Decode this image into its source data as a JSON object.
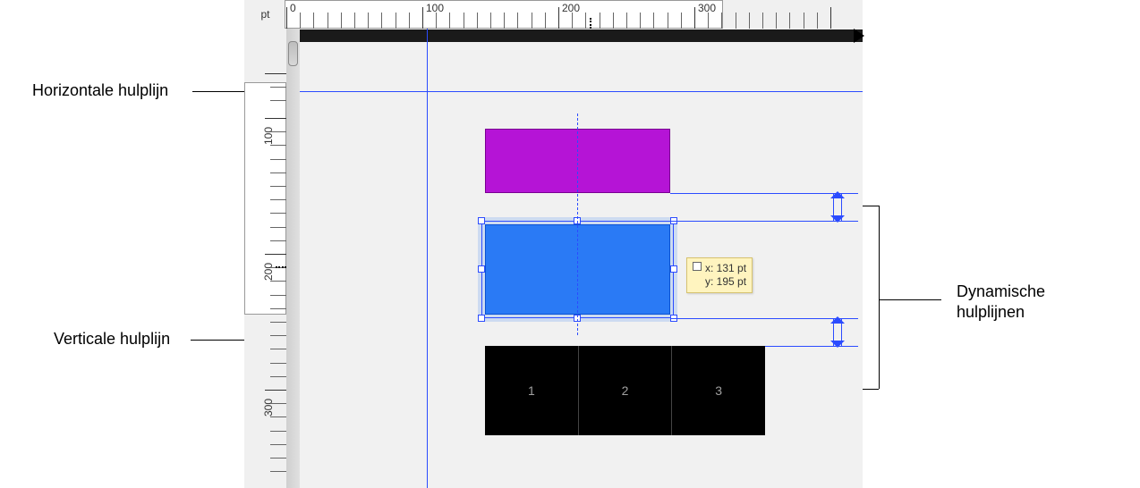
{
  "ruler": {
    "unit": "pt",
    "h_labels": [
      "0",
      "100",
      "200",
      "300"
    ],
    "v_labels": [
      "100",
      "200",
      "300"
    ]
  },
  "callouts": {
    "horizontal_guide": "Horizontale hulplijn",
    "vertical_guide": "Verticale hulplijn",
    "dynamic_guides_line1": "Dynamische",
    "dynamic_guides_line2": "hulplijnen"
  },
  "tooltip": {
    "x_label": "x: 131 pt",
    "y_label": "y: 195 pt"
  },
  "boxes": {
    "cells": [
      "1",
      "2",
      "3"
    ]
  }
}
